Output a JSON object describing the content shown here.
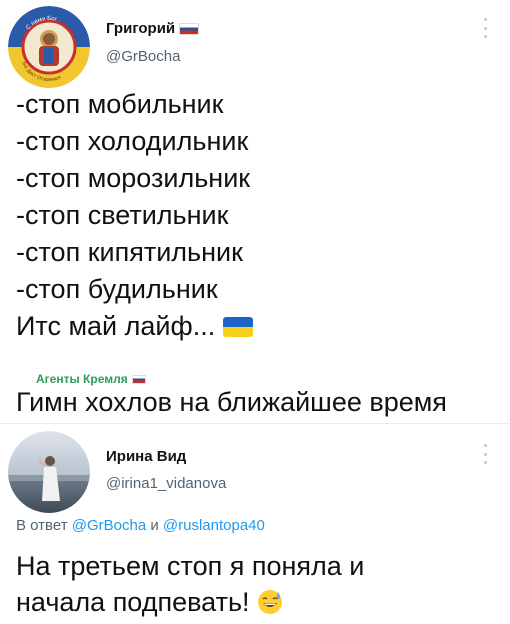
{
  "tweet": {
    "author_name": "Григорий",
    "handle": "@GrBocha",
    "avatar_text_top": "С нами Бог",
    "avatar_text_bottom": "Бог Даст Отзовемся",
    "lines": [
      "-стоп мобильник",
      "-стоп холодильник",
      "-стоп морозильник",
      "-стоп светильник",
      "-стоп кипятильник",
      "-стоп будильник",
      "Итс май лайф..."
    ]
  },
  "quote": {
    "author": "Агенты Кремля",
    "text": "Гимн хохлов на ближайшее время"
  },
  "reply": {
    "author_name": "Ирина Вид",
    "handle": "@irina1_vidanova",
    "reply_prefix": "В ответ",
    "mention_1": "@GrBocha",
    "conjunction": "и",
    "mention_2": "@ruslantopa40",
    "body_line1": "На третьем стоп я поняла и",
    "body_line2": "начала подпевать!"
  },
  "colors": {
    "text": "#0f1419",
    "secondary": "#536471",
    "link": "#1d9bf0",
    "quote_author": "#2d9d5b",
    "flag_ua_blue": "#1c64c8",
    "flag_ua_yellow": "#f7d117"
  },
  "icons": {
    "more": "more-dots-icon",
    "flag_ru": "russia-flag-icon",
    "flag_ua": "ukraine-flag-icon",
    "emoji": "sweat-smile-emoji-icon"
  }
}
